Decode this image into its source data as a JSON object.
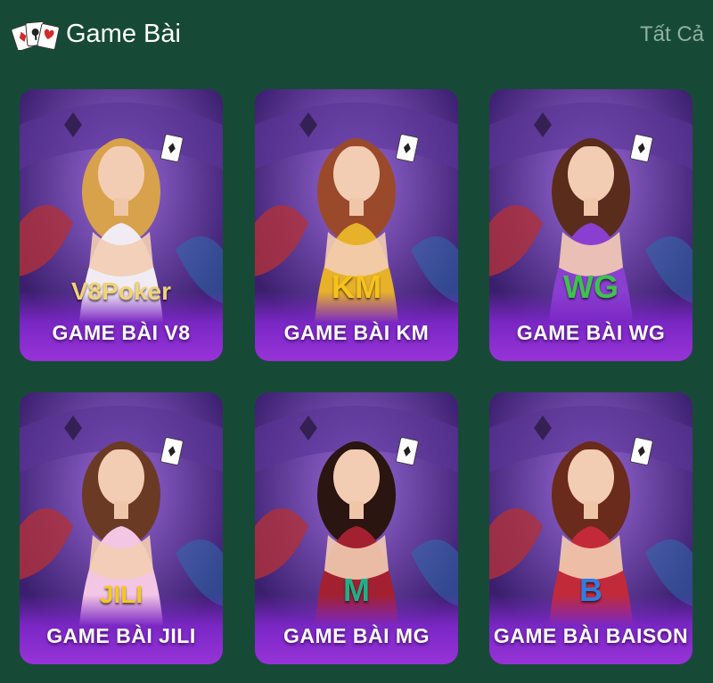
{
  "header": {
    "title": "Game Bài",
    "see_all_label": "Tất Cả"
  },
  "games": [
    {
      "label": "GAME BÀI V8",
      "logo_text": "V8Poker",
      "icon": "v8poker-logo-icon",
      "hair": "#d7a24b",
      "dress": "#f1ecf4",
      "logo_color": "#f2d27a"
    },
    {
      "label": "GAME BÀI KM",
      "logo_text": "KM",
      "icon": "km-logo-icon",
      "hair": "#9a4a2a",
      "dress": "#e7b12a",
      "logo_color": "#f6c21d"
    },
    {
      "label": "GAME BÀI WG",
      "logo_text": "WG",
      "icon": "wg-logo-icon",
      "hair": "#5a2c1c",
      "dress": "#8a3fd0",
      "logo_color": "#3cc44a"
    },
    {
      "label": "GAME BÀI JILI",
      "logo_text": "JILI",
      "icon": "jili-logo-icon",
      "hair": "#6b3a24",
      "dress": "#f3c6e4",
      "logo_color": "#f5c91e"
    },
    {
      "label": "GAME BÀI MG",
      "logo_text": "M",
      "icon": "mg-logo-icon",
      "hair": "#2a1510",
      "dress": "#a32030",
      "logo_color": "#1fb08a"
    },
    {
      "label": "GAME BÀI BAISON",
      "logo_text": "B",
      "icon": "baison-logo-icon",
      "hair": "#6a2a1c",
      "dress": "#c22a3a",
      "logo_color": "#2f7de0"
    }
  ]
}
